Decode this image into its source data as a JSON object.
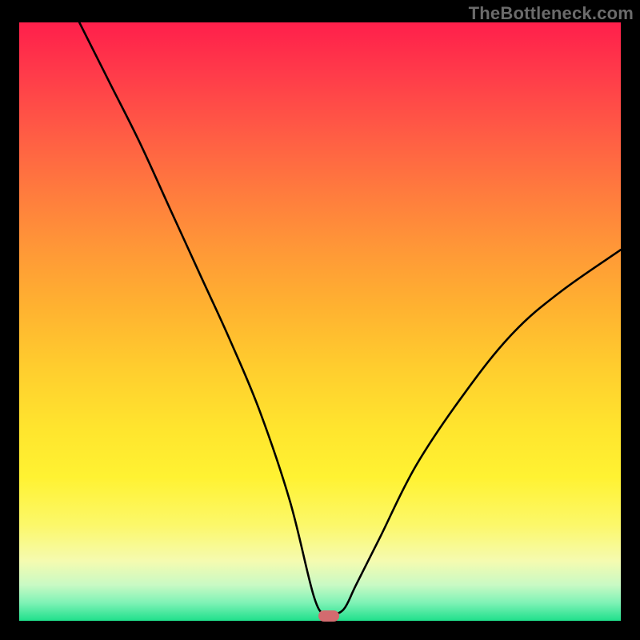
{
  "watermark": "TheBottleneck.com",
  "chart_data": {
    "type": "line",
    "title": "",
    "xlabel": "",
    "ylabel": "",
    "xlim": [
      0,
      100
    ],
    "ylim": [
      0,
      100
    ],
    "grid": false,
    "background_gradient": {
      "top": "#ff1f4b",
      "bottom": "#1fe08b",
      "mode": "vertical"
    },
    "series": [
      {
        "name": "bottleneck-curve",
        "color": "#000000",
        "x": [
          10,
          15,
          20,
          25,
          30,
          35,
          40,
          45,
          49,
          51,
          52,
          54,
          56,
          60,
          66,
          74,
          82,
          90,
          100
        ],
        "y": [
          100,
          90,
          80,
          69,
          58,
          47,
          35,
          20,
          4,
          1,
          1,
          2,
          6,
          14,
          26,
          38,
          48,
          55,
          62
        ]
      }
    ],
    "annotations": [
      {
        "name": "optimal-marker",
        "shape": "pill",
        "color": "#d36b6f",
        "x": 51.5,
        "y": 0.8
      }
    ]
  }
}
